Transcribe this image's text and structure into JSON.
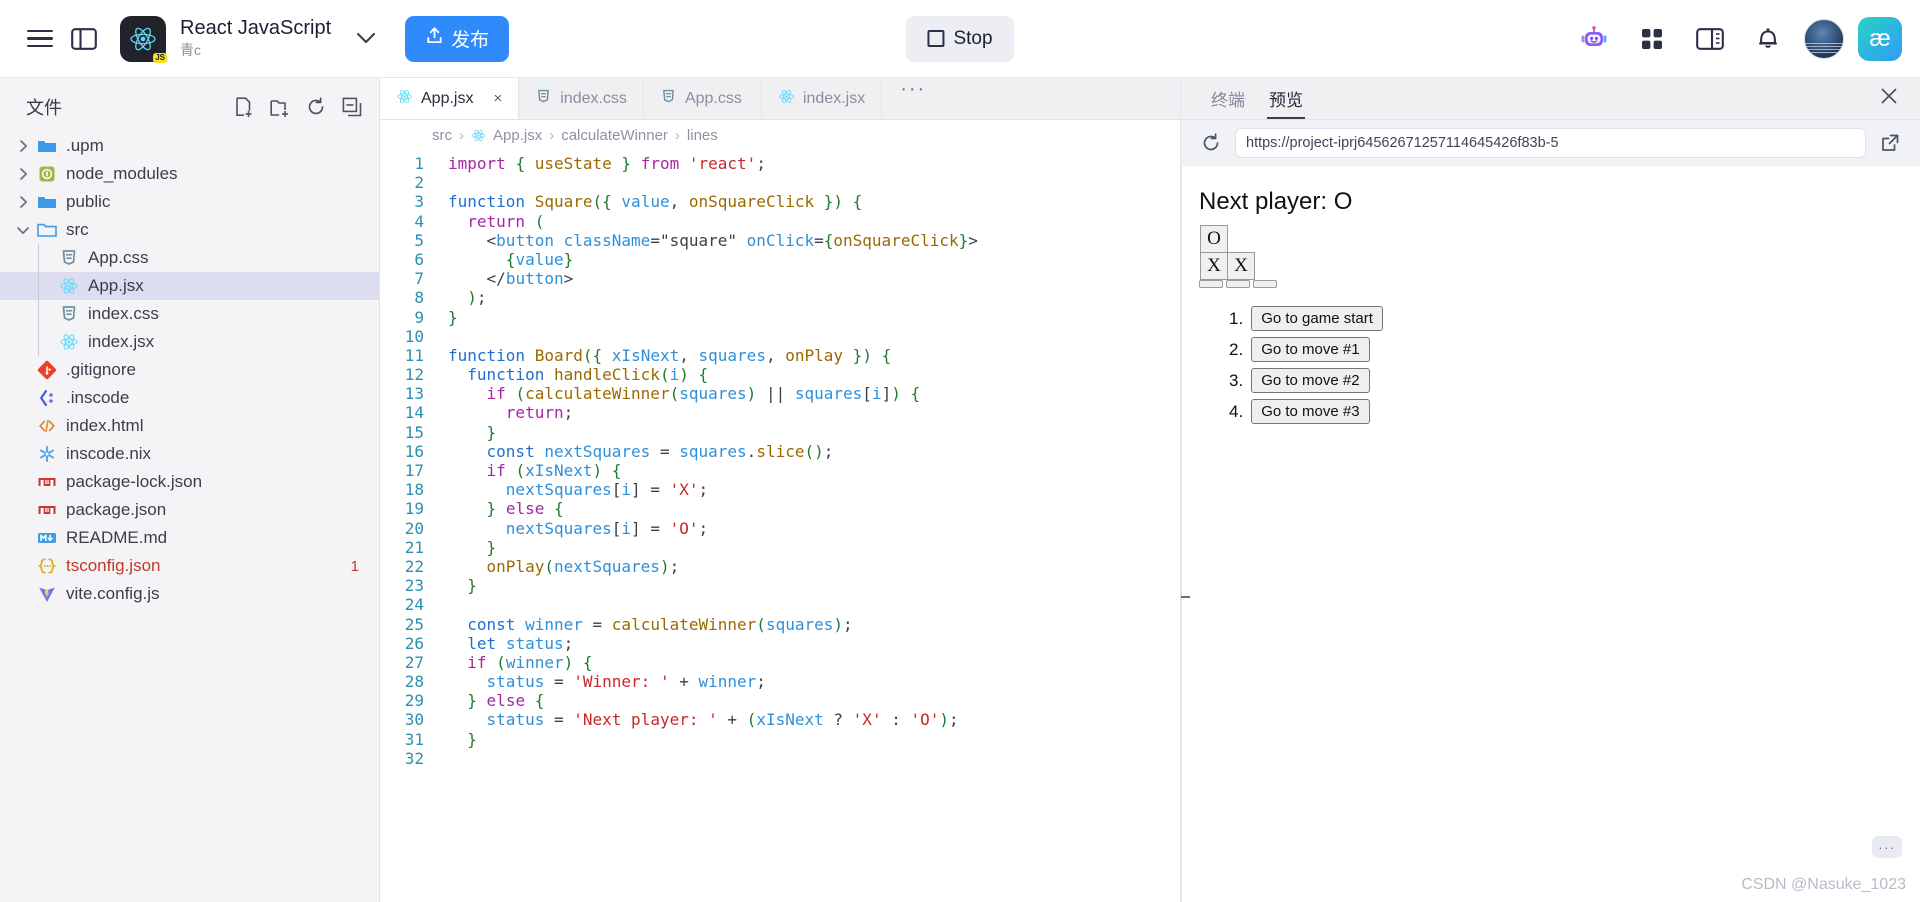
{
  "topbar": {
    "menu_icon": "hamburger-icon",
    "panel_icon": "toggle-sidebar-icon",
    "project_title": "React JavaScript",
    "project_subtitle": "青c",
    "project_logo_badge": "JS",
    "chevron_icon": "chevron-down-icon",
    "publish_label": "发布",
    "publish_icon": "upload-icon",
    "publish_color": "#2f8bfb",
    "stop_label": "Stop",
    "stop_icon": "stop-square-icon",
    "right_icons": [
      "robot-icon",
      "grid-apps-icon",
      "layout-panel-icon",
      "bell-icon"
    ],
    "ae_logo_text": "æ"
  },
  "sidebar": {
    "title": "文件",
    "actions": [
      "new-file-icon",
      "new-folder-icon",
      "refresh-icon",
      "collapse-all-icon"
    ],
    "tree": [
      {
        "label": ".upm",
        "icon": "folder-blue-icon",
        "twist": "›",
        "depth": 0
      },
      {
        "label": "node_modules",
        "icon": "folder-npm-icon",
        "twist": "›",
        "depth": 0
      },
      {
        "label": "public",
        "icon": "folder-blue-icon",
        "twist": "›",
        "depth": 0
      },
      {
        "label": "src",
        "icon": "folder-open-icon",
        "twist": "⌄",
        "depth": 0
      },
      {
        "label": "App.css",
        "icon": "css-icon",
        "twist": "",
        "depth": 1
      },
      {
        "label": "App.jsx",
        "icon": "react-icon",
        "twist": "",
        "depth": 1,
        "active": true
      },
      {
        "label": "index.css",
        "icon": "css-icon",
        "twist": "",
        "depth": 1
      },
      {
        "label": "index.jsx",
        "icon": "react-icon",
        "twist": "",
        "depth": 1
      },
      {
        "label": ".gitignore",
        "icon": "git-icon",
        "twist": "",
        "depth": 0
      },
      {
        "label": ".inscode",
        "icon": "inscode-icon",
        "twist": "",
        "depth": 0
      },
      {
        "label": "index.html",
        "icon": "html-icon",
        "twist": "",
        "depth": 0
      },
      {
        "label": "inscode.nix",
        "icon": "nix-icon",
        "twist": "",
        "depth": 0
      },
      {
        "label": "package-lock.json",
        "icon": "npm-icon",
        "twist": "",
        "depth": 0
      },
      {
        "label": "package.json",
        "icon": "npm-icon",
        "twist": "",
        "depth": 0
      },
      {
        "label": "README.md",
        "icon": "markdown-icon",
        "twist": "",
        "depth": 0
      },
      {
        "label": "tsconfig.json",
        "icon": "json-icon",
        "twist": "",
        "depth": 0,
        "error": true,
        "badge": "1"
      },
      {
        "label": "vite.config.js",
        "icon": "vite-icon",
        "twist": "",
        "depth": 0
      }
    ]
  },
  "editor": {
    "tabs": [
      {
        "label": "App.jsx",
        "icon": "react-icon",
        "active": true,
        "close": "×"
      },
      {
        "label": "index.css",
        "icon": "css-icon",
        "active": false
      },
      {
        "label": "App.css",
        "icon": "css-icon",
        "active": false
      },
      {
        "label": "index.jsx",
        "icon": "react-icon",
        "active": false
      }
    ],
    "more_icon": "···",
    "breadcrumb": [
      "src",
      "App.jsx",
      "calculateWinner",
      "lines"
    ],
    "first_line": 1,
    "last_line": 32,
    "lines": [
      "import { useState } from 'react';",
      "",
      "function Square({ value, onSquareClick }) {",
      "  return (",
      "    <button className=\"square\" onClick={onSquareClick}>",
      "      {value}",
      "    </button>",
      "  );",
      "}",
      "",
      "function Board({ xIsNext, squares, onPlay }) {",
      "  function handleClick(i) {",
      "    if (calculateWinner(squares) || squares[i]) {",
      "      return;",
      "    }",
      "    const nextSquares = squares.slice();",
      "    if (xIsNext) {",
      "      nextSquares[i] = 'X';",
      "    } else {",
      "      nextSquares[i] = 'O';",
      "    }",
      "    onPlay(nextSquares);",
      "  }",
      "",
      "  const winner = calculateWinner(squares);",
      "  let status;",
      "  if (winner) {",
      "    status = 'Winner: ' + winner;",
      "  } else {",
      "    status = 'Next player: ' + (xIsNext ? 'X' : 'O');",
      "  }",
      ""
    ]
  },
  "preview": {
    "tabs": [
      {
        "label": "终端",
        "active": false
      },
      {
        "label": "预览",
        "active": true
      }
    ],
    "close_icon": "close-icon",
    "reload_icon": "reload-icon",
    "url": "https://project-iprj64562671257114645426f83b-5",
    "open_external_icon": "open-external-icon",
    "app": {
      "status": "Next player: O",
      "board": [
        [
          "",
          "O",
          ""
        ],
        [
          "",
          "X",
          "X"
        ],
        [
          "",
          "",
          ""
        ]
      ],
      "moves": [
        {
          "number": "1.",
          "label": "Go to game start"
        },
        {
          "number": "2.",
          "label": "Go to move #1"
        },
        {
          "number": "3.",
          "label": "Go to move #2"
        },
        {
          "number": "4.",
          "label": "Go to move #3"
        }
      ]
    },
    "watermark": "CSDN @Nasuke_1023"
  }
}
